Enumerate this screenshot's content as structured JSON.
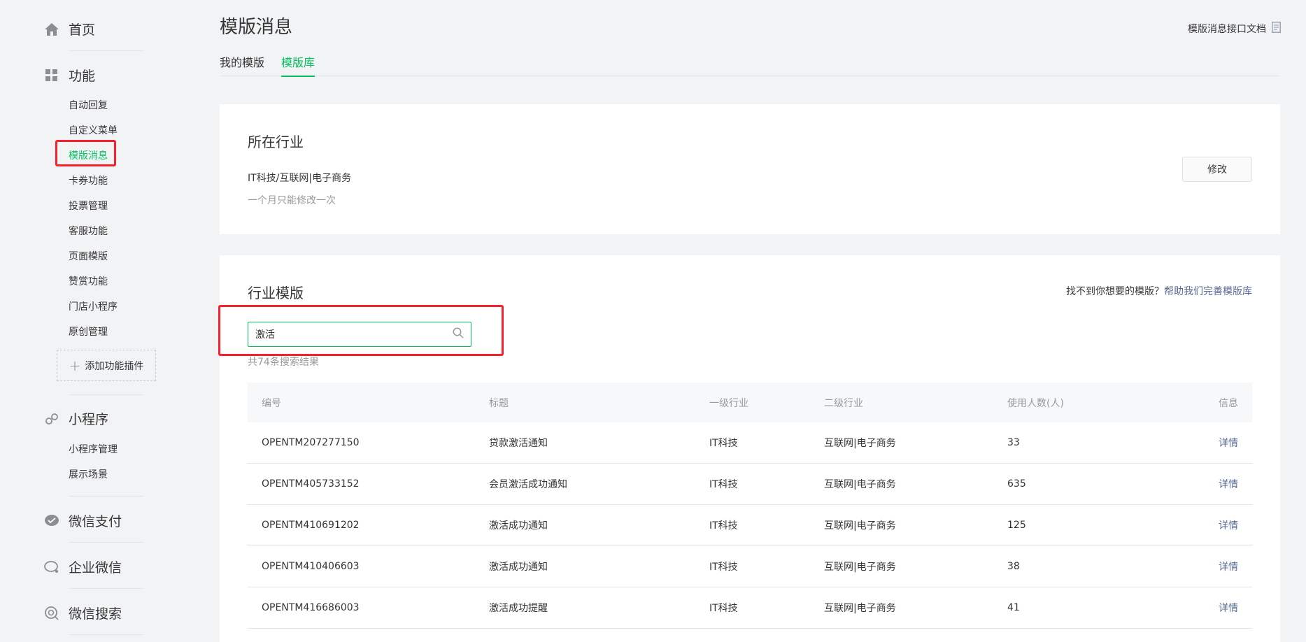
{
  "sidebar": {
    "home": "首页",
    "features": "功能",
    "feature_items": [
      "自动回复",
      "自定义菜单",
      "模版消息",
      "卡券功能",
      "投票管理",
      "客服功能",
      "页面模版",
      "赞赏功能",
      "门店小程序",
      "原创管理"
    ],
    "add_plugin": "添加功能插件",
    "miniprogram": "小程序",
    "miniprogram_items": [
      "小程序管理",
      "展示场景"
    ],
    "wechat_pay": "微信支付",
    "work_wechat": "企业微信",
    "wechat_search": "微信搜索"
  },
  "header": {
    "title": "模版消息",
    "doc_link": "模版消息接口文档",
    "tabs": [
      "我的模版",
      "模版库"
    ]
  },
  "industry": {
    "title": "所在行业",
    "value": "IT科技/互联网|电子商务",
    "note": "一个月只能修改一次",
    "modify": "修改"
  },
  "templates": {
    "title": "行业模版",
    "help_prefix": "找不到你想要的模版？",
    "help_link": "帮助我们完善模版库",
    "search_value": "激活",
    "result_count": "共74条搜索结果",
    "columns": [
      "编号",
      "标题",
      "一级行业",
      "二级行业",
      "使用人数(人)",
      "信息"
    ],
    "rows": [
      {
        "id": "OPENTM207277150",
        "title": "贷款激活通知",
        "l1": "IT科技",
        "l2": "互联网|电子商务",
        "users": "33",
        "info": "详情"
      },
      {
        "id": "OPENTM405733152",
        "title": "会员激活成功通知",
        "l1": "IT科技",
        "l2": "互联网|电子商务",
        "users": "635",
        "info": "详情"
      },
      {
        "id": "OPENTM410691202",
        "title": "激活成功通知",
        "l1": "IT科技",
        "l2": "互联网|电子商务",
        "users": "125",
        "info": "详情"
      },
      {
        "id": "OPENTM410406603",
        "title": "激活成功通知",
        "l1": "IT科技",
        "l2": "互联网|电子商务",
        "users": "38",
        "info": "详情"
      },
      {
        "id": "OPENTM416686003",
        "title": "激活成功提醒",
        "l1": "IT科技",
        "l2": "互联网|电子商务",
        "users": "41",
        "info": "详情"
      }
    ]
  },
  "colors": {
    "accent": "#07c160",
    "link": "#576b95",
    "highlight": "#f5222d"
  }
}
